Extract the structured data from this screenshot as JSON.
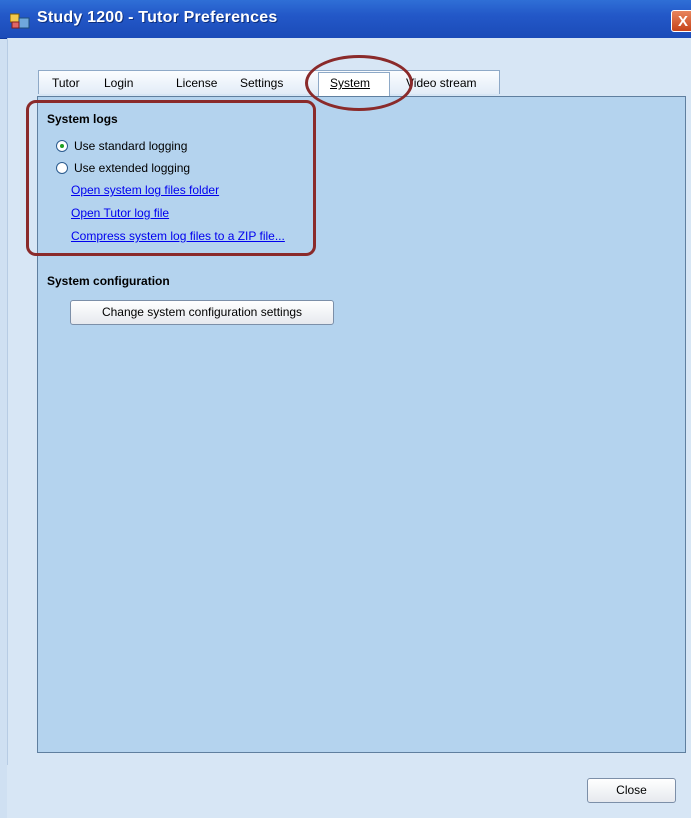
{
  "window": {
    "title": "Study 1200 - Tutor Preferences",
    "close_glyph": "X"
  },
  "tabs": [
    {
      "label": "Tutor"
    },
    {
      "label": "Login"
    },
    {
      "label": "License"
    },
    {
      "label": "Settings"
    },
    {
      "label": "System",
      "active": true
    },
    {
      "label": "Video stream"
    }
  ],
  "system_logs": {
    "title": "System logs",
    "options": [
      {
        "label": "Use standard logging",
        "checked": true
      },
      {
        "label": "Use extended logging",
        "checked": false
      }
    ],
    "links": [
      "Open system log files folder",
      "Open Tutor log file",
      "Compress system log files to a ZIP file..."
    ]
  },
  "system_configuration": {
    "title": "System configuration",
    "button_label": "Change system configuration settings"
  },
  "footer": {
    "close_label": "Close"
  },
  "colors": {
    "titlebar": "#2358c8",
    "panel": "#b4d3ee",
    "annotation": "#8a2a2a",
    "link": "#0000ee"
  },
  "icons": {
    "app": "app-icon",
    "close": "close-icon"
  }
}
